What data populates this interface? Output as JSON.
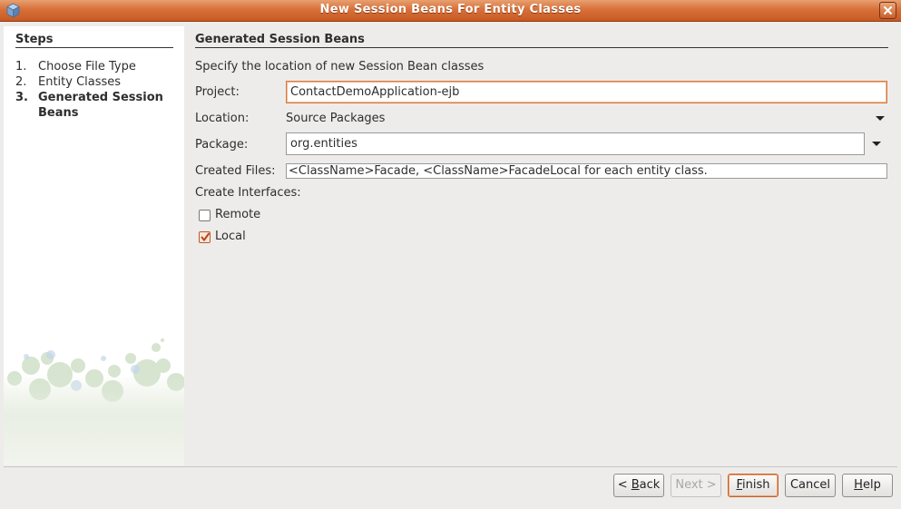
{
  "window": {
    "title": "New Session Beans For Entity Classes"
  },
  "steps": {
    "title": "Steps",
    "items": [
      {
        "num": "1.",
        "label": "Choose File Type"
      },
      {
        "num": "2.",
        "label": "Entity Classes"
      },
      {
        "num": "3.",
        "label": "Generated Session Beans"
      }
    ]
  },
  "main": {
    "title": "Generated Session Beans",
    "description": "Specify the location of new Session Bean classes",
    "project_label": "Project:",
    "project_value": "ContactDemoApplication-ejb",
    "location_label": "Location:",
    "location_value": "Source Packages",
    "package_label": "Package:",
    "package_value": "org.entities",
    "created_files_label": "Created Files:",
    "created_files_value": "<ClassName>Facade, <ClassName>FacadeLocal for each entity class.",
    "create_interfaces_label": "Create Interfaces:",
    "remote_label": "Remote",
    "remote_checked": false,
    "local_label": "Local",
    "local_checked": true
  },
  "buttons": {
    "back": {
      "prefix": "< ",
      "mnemonic": "B",
      "rest": "ack"
    },
    "next": "Next >",
    "finish": {
      "mnemonic": "F",
      "rest": "inish"
    },
    "cancel": "Cancel",
    "help": {
      "mnemonic": "H",
      "rest": "elp"
    }
  },
  "colors": {
    "titlebar": "#d8703a",
    "focus": "#d87a40",
    "accent_check": "#b85a2a"
  }
}
